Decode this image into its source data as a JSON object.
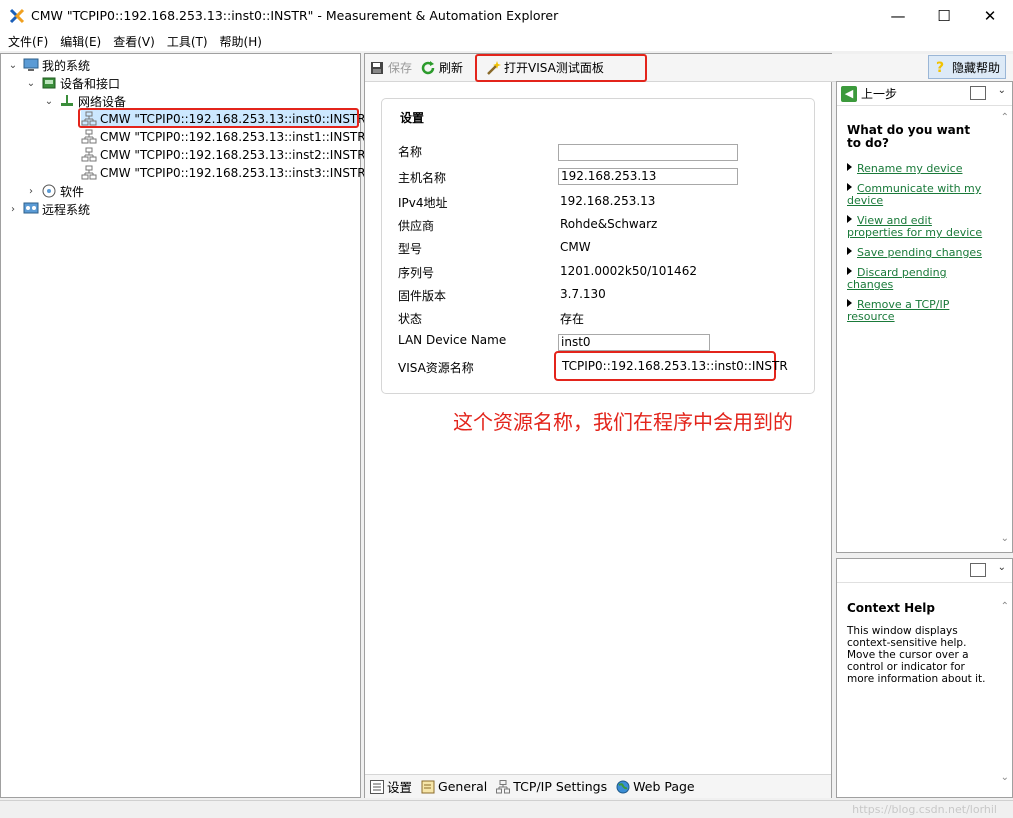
{
  "window": {
    "title": "CMW \"TCPIP0::192.168.253.13::inst0::INSTR\" - Measurement & Automation Explorer",
    "minimize": "—",
    "maximize": "☐",
    "close": "✕"
  },
  "menu": [
    "文件(F)",
    "编辑(E)",
    "查看(V)",
    "工具(T)",
    "帮助(H)"
  ],
  "tree": {
    "my_system": "我的系统",
    "devices": "设备和接口",
    "network": "网络设备",
    "instruments": [
      "CMW \"TCPIP0::192.168.253.13::inst0::INSTR\"",
      "CMW \"TCPIP0::192.168.253.13::inst1::INSTR\"",
      "CMW \"TCPIP0::192.168.253.13::inst2::INSTR\"",
      "CMW \"TCPIP0::192.168.253.13::inst3::INSTR\""
    ],
    "software": "软件",
    "remote": "远程系统"
  },
  "toolbar": {
    "save": "保存",
    "refresh": "刷新",
    "open_visa": "打开VISA测试面板",
    "hide_help": "隐藏帮助"
  },
  "settings": {
    "heading": "设置",
    "name_label": "名称",
    "name_value": "",
    "host_label": "主机名称",
    "host_value": "192.168.253.13",
    "ipv4_label": "IPv4地址",
    "ipv4_value": "192.168.253.13",
    "vendor_label": "供应商",
    "vendor_value": "Rohde&Schwarz",
    "model_label": "型号",
    "model_value": "CMW",
    "serial_label": "序列号",
    "serial_value": "1201.0002k50/101462",
    "firmware_label": "固件版本",
    "firmware_value": "3.7.130",
    "status_label": "状态",
    "status_value": "存在",
    "lan_label": "LAN Device Name",
    "lan_value": "inst0",
    "visa_label": "VISA资源名称",
    "visa_value": "TCPIP0::192.168.253.13::inst0::INSTR"
  },
  "annotation": "这个资源名称，我们在程序中会用到的",
  "bottom_tabs": [
    "设置",
    "General",
    "TCP/IP Settings",
    "Web Page"
  ],
  "help": {
    "back": "上一步",
    "heading": "What do you want to do?",
    "links": [
      "Rename my device",
      "Communicate with my device",
      "View and edit properties for my device",
      "Save pending changes",
      "Discard pending changes",
      "Remove a TCP/IP resource"
    ]
  },
  "context_help": {
    "heading": "Context Help",
    "body": "This window displays context-sensitive help. Move the cursor over a control or indicator for more information about it."
  },
  "watermark": "https://blog.csdn.net/lorhil",
  "colors": {
    "highlight_red": "#e3241b",
    "link_green": "#1a7a3a",
    "selection_blue": "#cce8ff"
  }
}
